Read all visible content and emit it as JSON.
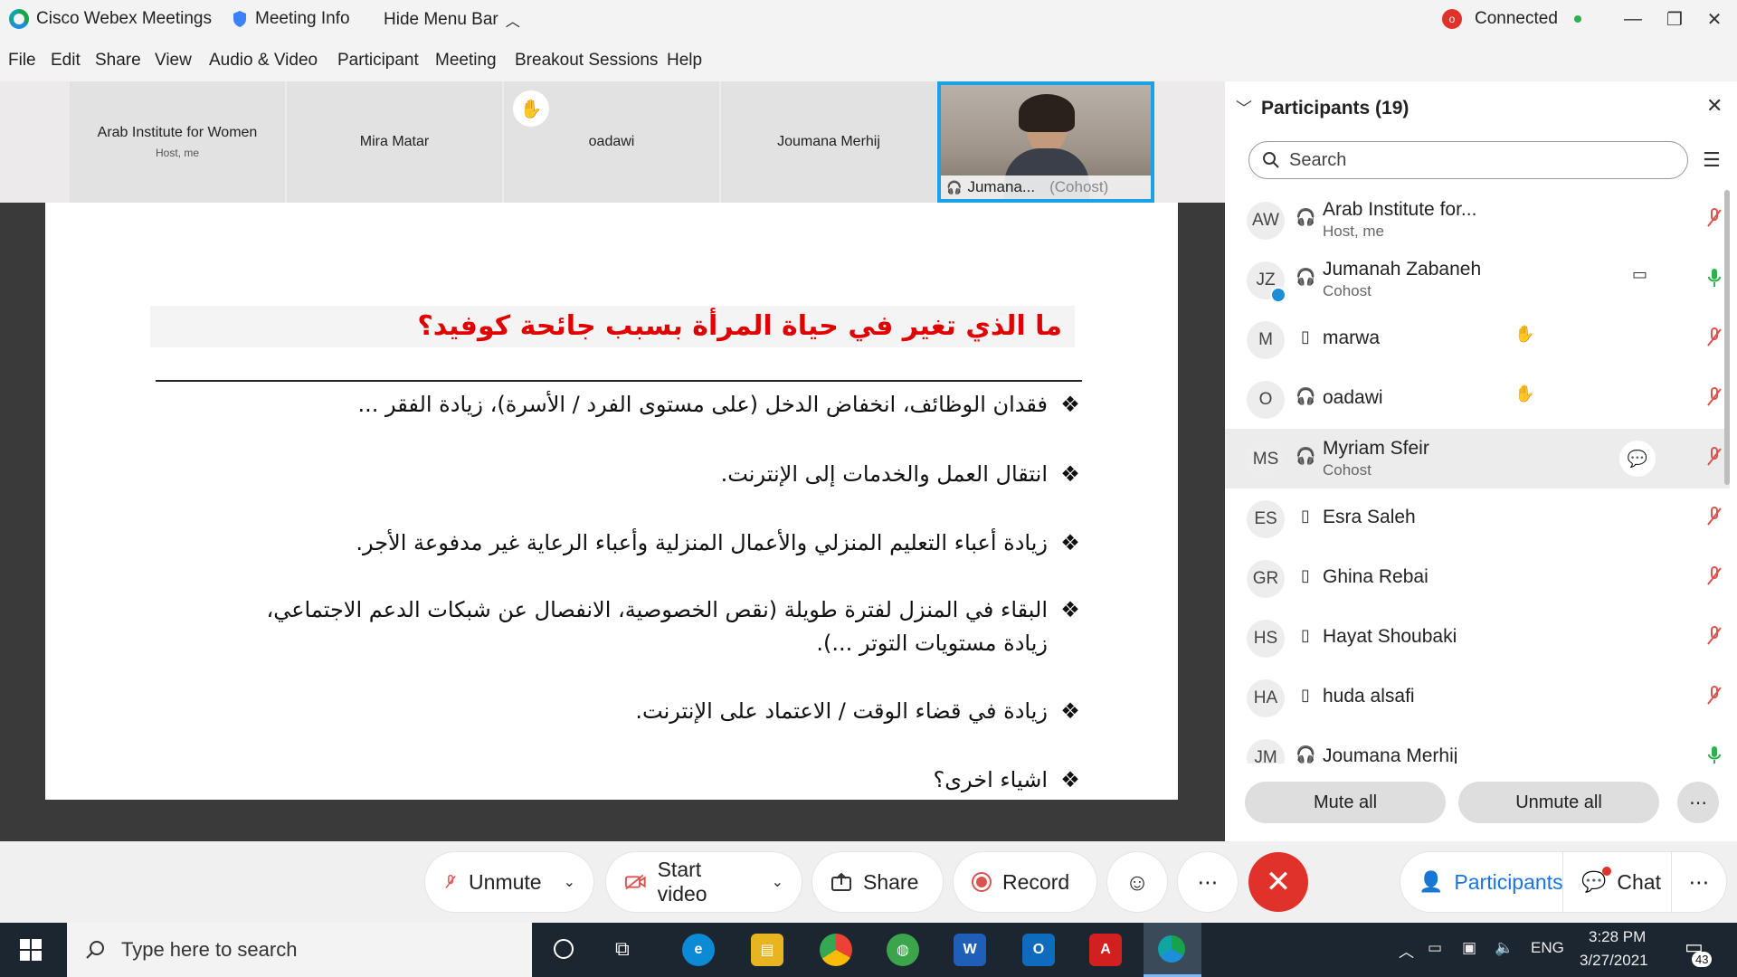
{
  "titlebar": {
    "app_name": "Cisco Webex Meetings",
    "meeting_info": "Meeting Info",
    "hide_menu_bar": "Hide Menu Bar",
    "connection_status": "Connected"
  },
  "menu": [
    "File",
    "Edit",
    "Share",
    "View",
    "Audio & Video",
    "Participant",
    "Meeting",
    "Breakout Sessions",
    "Help"
  ],
  "video_tiles": [
    {
      "name": "Arab Institute for Women",
      "sub": "Host, me"
    },
    {
      "name": "Mira Matar",
      "sub": ""
    },
    {
      "name": "oadawi",
      "sub": ""
    },
    {
      "name": "Joumana Merhij",
      "sub": ""
    }
  ],
  "active_speaker": {
    "name": "Jumana...",
    "role": "(Cohost)"
  },
  "slide": {
    "title": "ما الذي تغير في حياة المرأة بسبب جائحة كوفيد؟",
    "bullets": [
      "فقدان الوظائف، انخفاض الدخل (على مستوى الفرد / الأسرة)، زيادة الفقر ...",
      "انتقال العمل والخدمات إلى الإنترنت.",
      "زيادة أعباء التعليم المنزلي والأعمال المنزلية وأعباء الرعاية غير مدفوعة الأجر.",
      "البقاء في المنزل لفترة طويلة (نقص الخصوصية، الانفصال عن شبكات الدعم الاجتماعي، زيادة مستويات التوتر ...).",
      "زيادة  في قضاء الوقت / الاعتماد على الإنترنت.",
      "اشياء اخرى؟"
    ]
  },
  "participants_panel": {
    "title": "Participants (19)",
    "search_placeholder": "Search",
    "mute_all": "Mute all",
    "unmute_all": "Unmute all",
    "items": [
      {
        "initials": "AW",
        "name": "Arab Institute for...",
        "role": "Host, me",
        "mic": "muted"
      },
      {
        "initials": "JZ",
        "name": "Jumanah Zabaneh",
        "role": "Cohost",
        "mic": "on",
        "video": true
      },
      {
        "initials": "M",
        "name": "marwa",
        "role": "",
        "mic": "muted",
        "hand": true
      },
      {
        "initials": "O",
        "name": "oadawi",
        "role": "",
        "mic": "muted",
        "hand": true
      },
      {
        "initials": "MS",
        "name": "Myriam Sfeir",
        "role": "Cohost",
        "mic": "muted",
        "chat": true
      },
      {
        "initials": "ES",
        "name": "Esra Saleh",
        "role": "",
        "mic": "muted"
      },
      {
        "initials": "GR",
        "name": "Ghina Rebai",
        "role": "",
        "mic": "muted"
      },
      {
        "initials": "HS",
        "name": "Hayat Shoubaki",
        "role": "",
        "mic": "muted"
      },
      {
        "initials": "HA",
        "name": "huda alsafi",
        "role": "",
        "mic": "muted"
      },
      {
        "initials": "JM",
        "name": "Joumana Merhij",
        "role": "",
        "mic": "on"
      }
    ]
  },
  "controls": {
    "unmute": "Unmute",
    "start_video": "Start video",
    "share": "Share",
    "record": "Record",
    "participants": "Participants",
    "chat": "Chat"
  },
  "taskbar": {
    "search_placeholder": "Type here to search",
    "language": "ENG",
    "time": "3:28 PM",
    "date": "3/27/2021",
    "notifications": "43"
  },
  "colors": {
    "accent": "#1aa1e6",
    "end_call": "#e0312a",
    "slide_title": "#e00000",
    "mic_muted": "#d9534f",
    "mic_on": "#2bb24c"
  }
}
